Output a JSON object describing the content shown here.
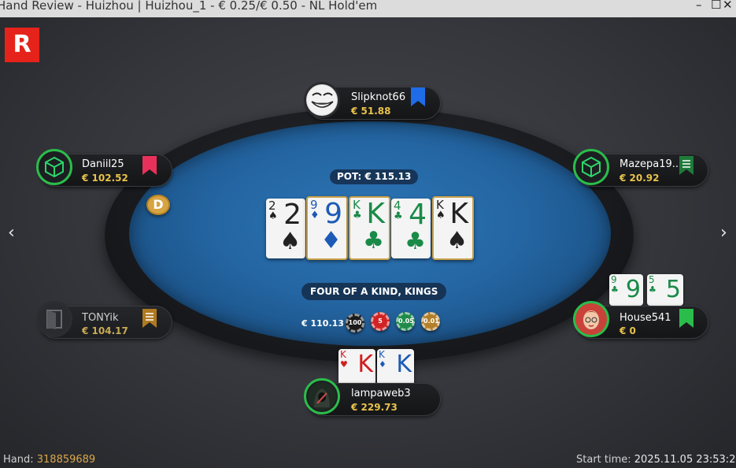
{
  "window": {
    "title": "Hand Review - Huizhou | Huizhou_1 - € 0.25/€ 0.50 - NL Hold'em",
    "minimize_glyph": "–",
    "maximize_glyph": "☐",
    "close_glyph": "✕"
  },
  "logo": {
    "letter": "R",
    "color": "#e5231b"
  },
  "navigation": {
    "prev_glyph": "‹",
    "next_glyph": "›"
  },
  "pot": {
    "label": "POT: € 115.13"
  },
  "hand_result": "FOUR OF A KIND, KINGS",
  "board": [
    {
      "rank": "2",
      "suit": "♠",
      "color": "black"
    },
    {
      "rank": "9",
      "suit": "♦",
      "color": "blue"
    },
    {
      "rank": "K",
      "suit": "♣",
      "color": "green"
    },
    {
      "rank": "4",
      "suit": "♣",
      "color": "green"
    },
    {
      "rank": "K",
      "suit": "♠",
      "color": "black"
    }
  ],
  "players": [
    {
      "name": "Slipknot66",
      "stack": "€ 51.88",
      "avatar": "troll-face",
      "flag_color": "#1e6ce8"
    },
    {
      "name": "Daniil25",
      "stack": "€ 102.52",
      "avatar": "cube-logo",
      "flag_color": "#e8315a"
    },
    {
      "name": "Mazepa19...",
      "stack": "€ 20.92",
      "avatar": "cube-logo",
      "flag_color": "#1f7a3a"
    },
    {
      "name": "TONYik",
      "stack": "€ 104.17",
      "avatar": "door",
      "flag_color": "#b07a20"
    },
    {
      "name": "House541",
      "stack": "€ 0",
      "avatar": "red-hair-woman",
      "flag_color": "#2bbd4b",
      "cards": [
        {
          "rank": "9",
          "suit": "♣"
        },
        {
          "rank": "5",
          "suit": "♣"
        }
      ]
    },
    {
      "name": "lampaweb3",
      "stack": "€ 229.73",
      "avatar": "hooded-figure",
      "cards": [
        {
          "rank": "K",
          "suit": "♥"
        },
        {
          "rank": "K",
          "suit": "♦"
        }
      ]
    }
  ],
  "dealer_button": "D",
  "bet": {
    "amount": "€ 110.13",
    "chips": [
      {
        "label": "100",
        "color": "#1a1a1a"
      },
      {
        "label": "5",
        "color": "#d02424"
      },
      {
        "label": "0.05",
        "color": "#1f8a4a"
      },
      {
        "label": "0.01",
        "color": "#b27f2a"
      }
    ]
  },
  "footer": {
    "hand_label": "Hand:",
    "hand_number": "318859689",
    "start_label": "Start time:",
    "start_time": "2025.11.05 23:53:29"
  }
}
